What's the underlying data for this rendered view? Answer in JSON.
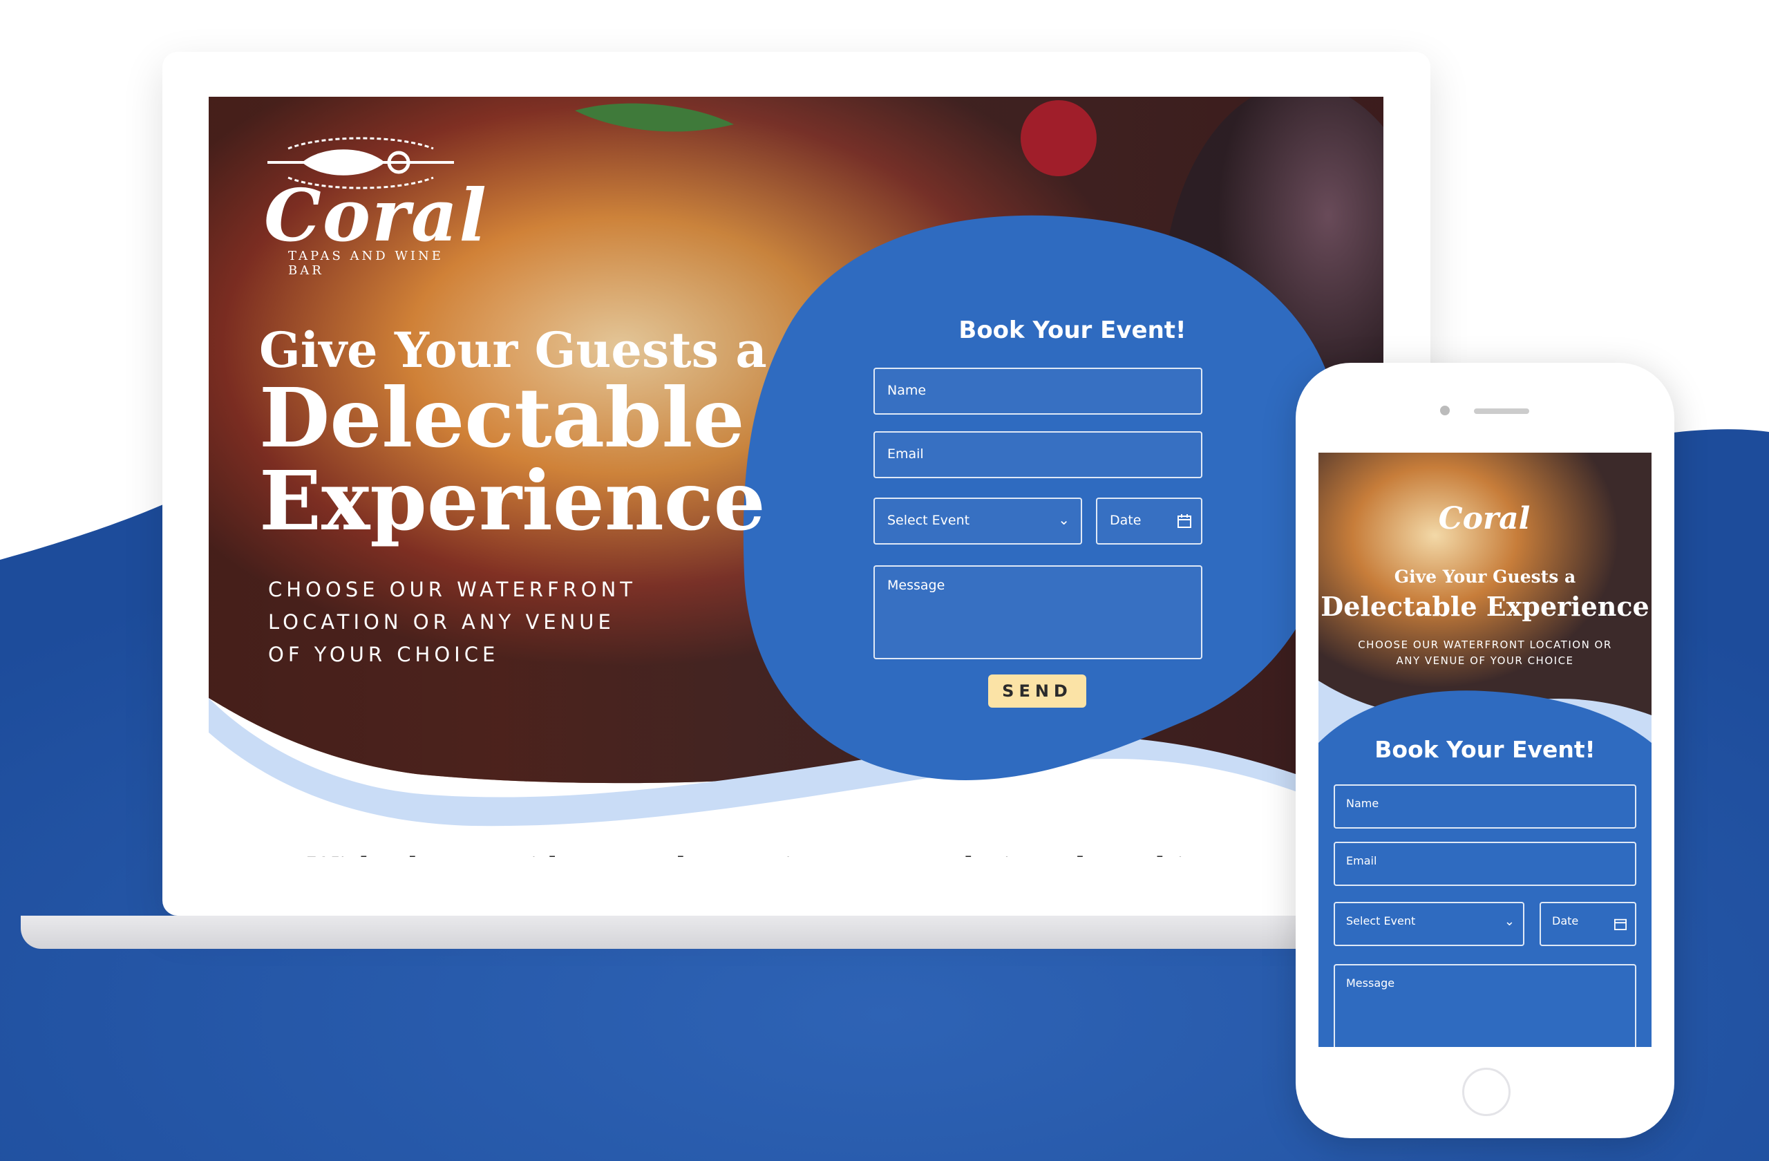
{
  "brand": {
    "logo_text": "Coral",
    "logo_subtitle": "TAPAS AND WINE BAR"
  },
  "hero": {
    "headline_line1": "Give Your Guests a",
    "headline_line2": "Delectable",
    "headline_line3": "Experience",
    "tagline": "CHOOSE OUR WATERFRONT LOCATION OR ANY VENUE OF YOUR CHOICE"
  },
  "form": {
    "title": "Book Your Event!",
    "name_placeholder": "Name",
    "email_placeholder": "Email",
    "event_select_label": "Select Event",
    "date_placeholder": "Date",
    "message_placeholder": "Message",
    "send_label": "SEND"
  },
  "caption": "With photos, videos, and experiences now being shared in near",
  "mobile": {
    "logo_text": "Coral",
    "headline_line1": "Give Your Guests a",
    "headline_line2": "Delectable Experience",
    "tagline": "CHOOSE OUR WATERFRONT LOCATION OR ANY VENUE OF YOUR CHOICE",
    "form_title": "Book Your Event!",
    "name_placeholder": "Name",
    "email_placeholder": "Email",
    "event_select_label": "Select Event",
    "date_placeholder": "Date",
    "message_placeholder": "Message"
  },
  "colors": {
    "brand_blue": "#2f6bc0",
    "dark_blue": "#1f4fa0",
    "send_button": "#fbe3a6",
    "light_wave": "#c9dcf6"
  }
}
